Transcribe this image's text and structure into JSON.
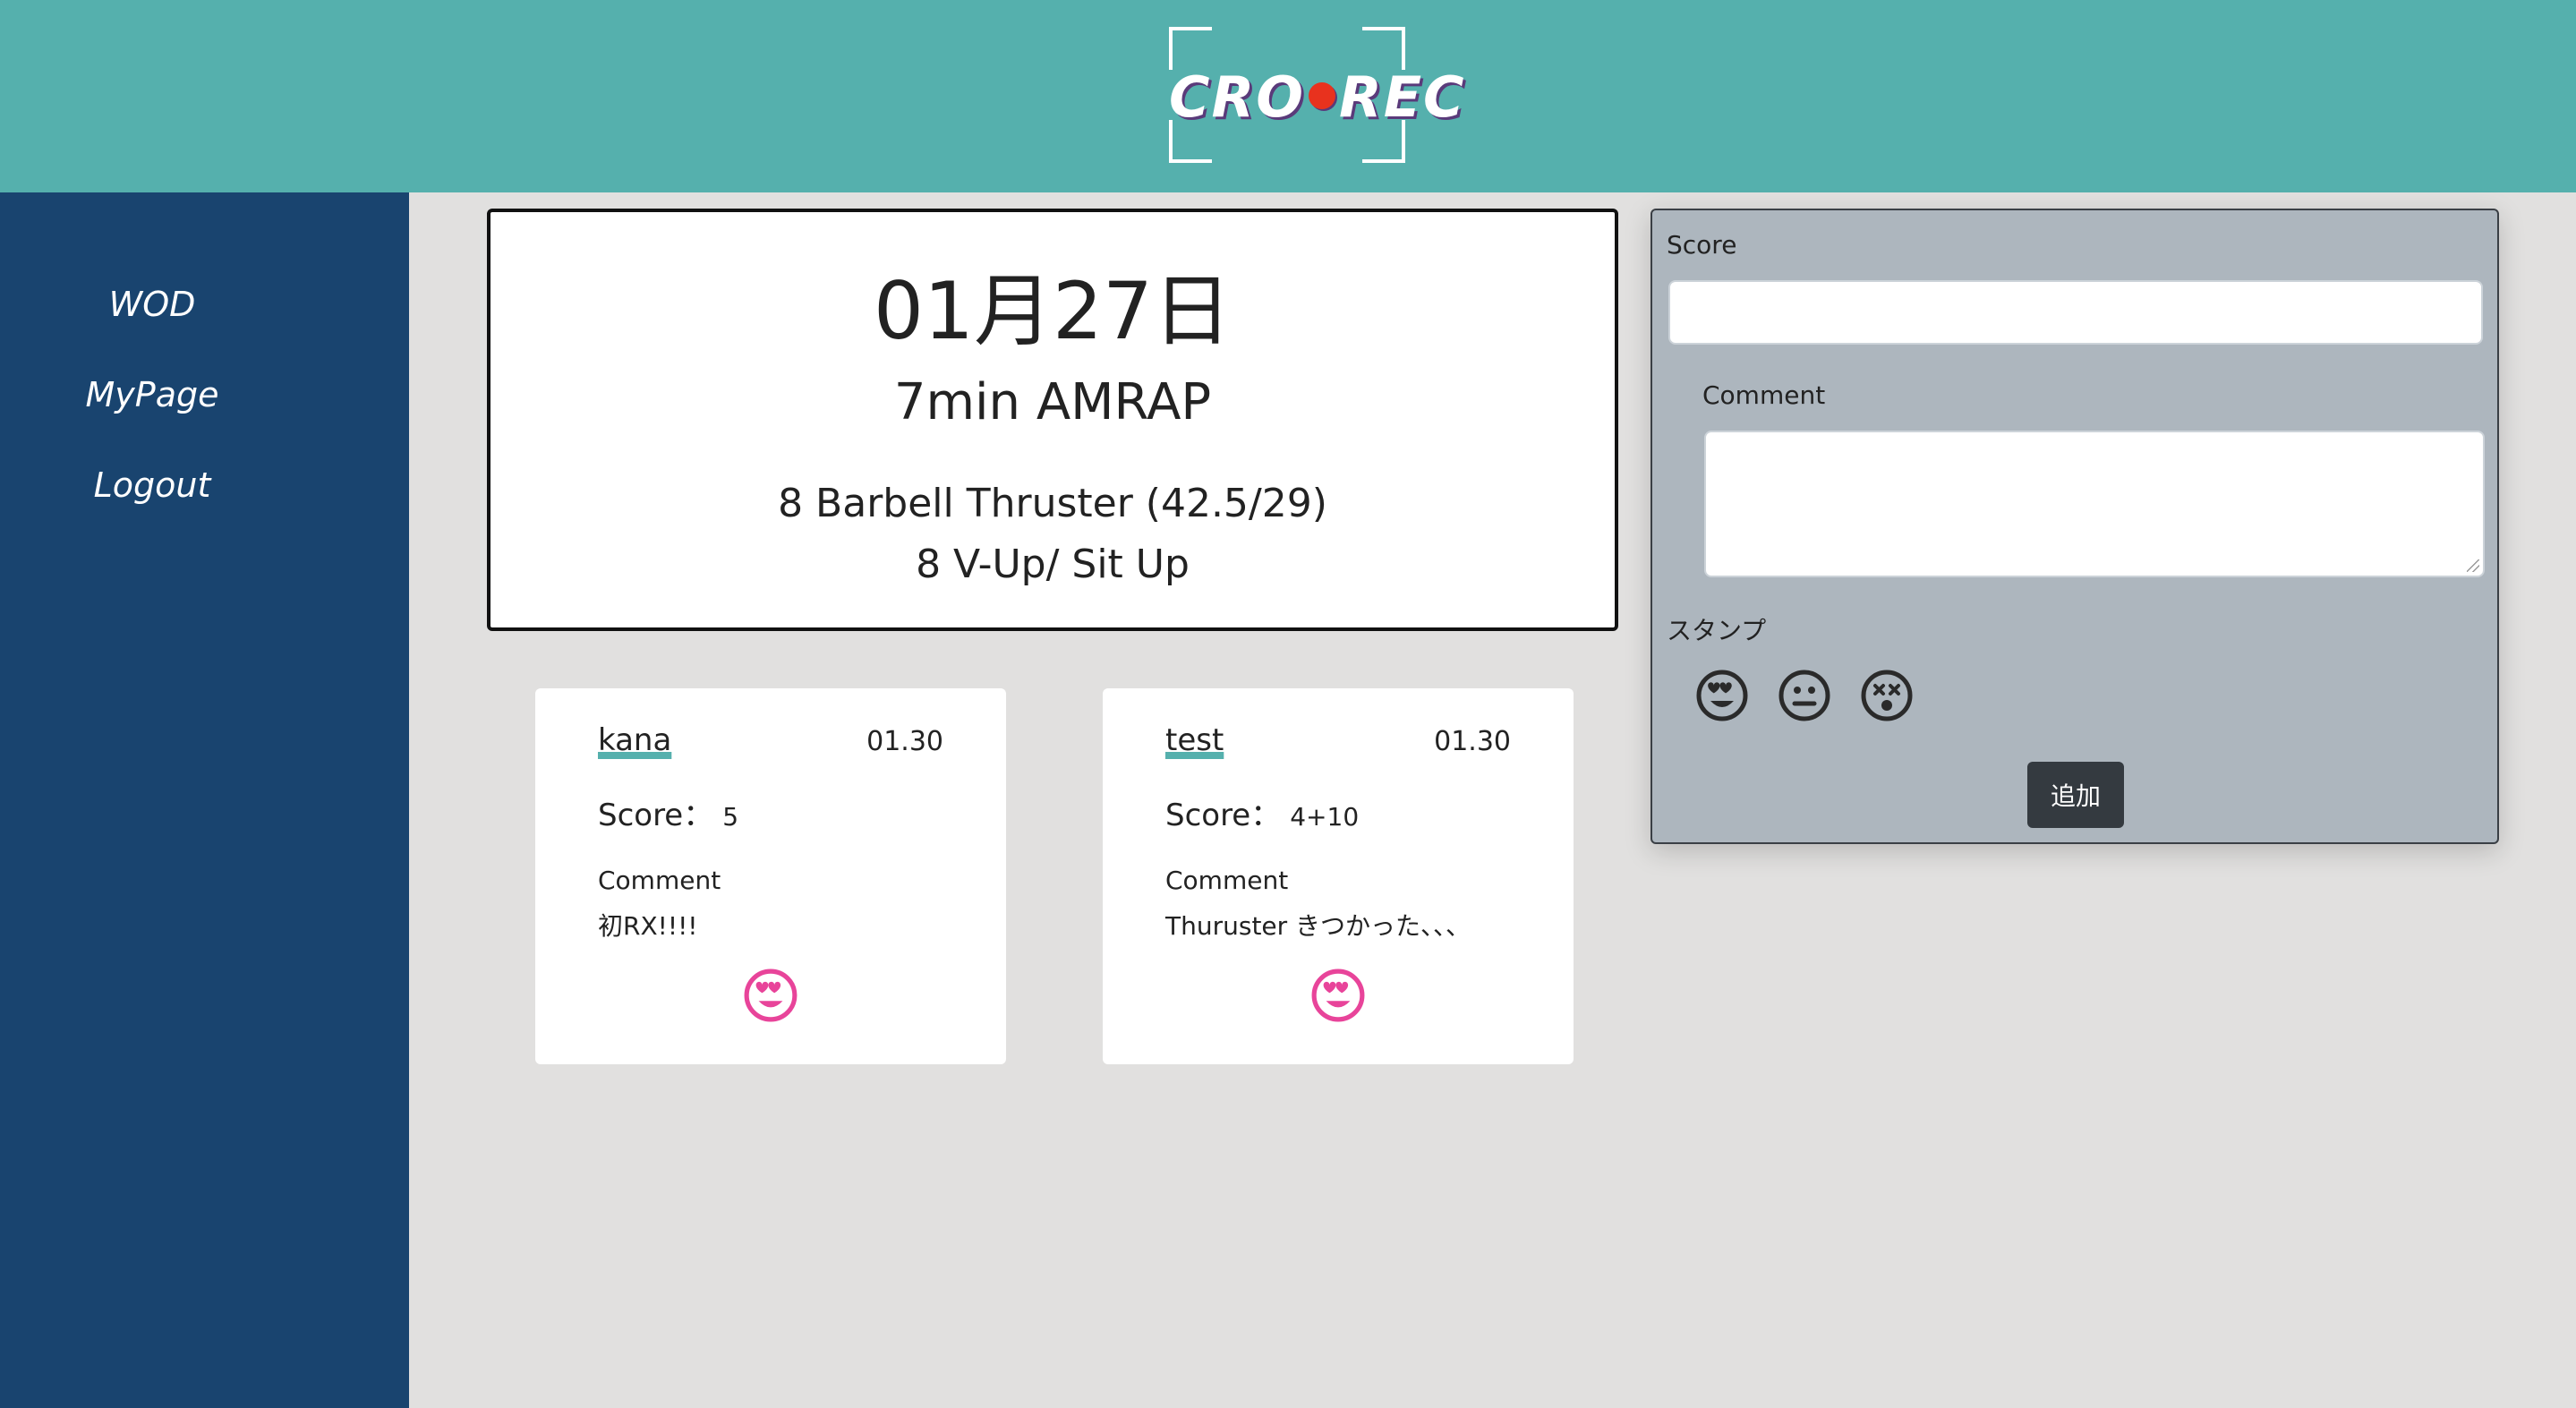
{
  "header": {
    "logo_text_left": "CRO",
    "logo_text_right": "REC"
  },
  "sidebar": {
    "items": [
      {
        "label": "WOD"
      },
      {
        "label": "MyPage"
      },
      {
        "label": "Logout"
      }
    ]
  },
  "wod": {
    "date": "01月27日",
    "title": "7min AMRAP",
    "movements": [
      "8 Barbell Thruster (42.5/29)",
      "8 V-Up/ Sit Up"
    ]
  },
  "form": {
    "score_label": "Score",
    "score_value": "",
    "comment_label": "Comment",
    "comment_value": "",
    "stamp_label": "スタンプ",
    "stamps": [
      "heart-eyes-face-icon",
      "neutral-face-icon",
      "dizzy-face-icon"
    ],
    "submit_label": "追加"
  },
  "posts": [
    {
      "user": "kana",
      "date": "01.30",
      "score_label": "Score：",
      "score": "5",
      "comment_label": "Comment",
      "comment": "初RX!!!!",
      "stamp": "heart-eyes-face-icon",
      "stamp_color": "#e8449a"
    },
    {
      "user": "test",
      "date": "01.30",
      "score_label": "Score：",
      "score": "4+10",
      "comment_label": "Comment",
      "comment": "Thuruster きつかった、、、",
      "stamp": "heart-eyes-face-icon",
      "stamp_color": "#e8449a"
    }
  ],
  "colors": {
    "header": "#55b0ad",
    "sidebar": "#19446f",
    "background": "#e1e0df",
    "form_panel": "#adb6be",
    "accent": "#55b0ad"
  }
}
